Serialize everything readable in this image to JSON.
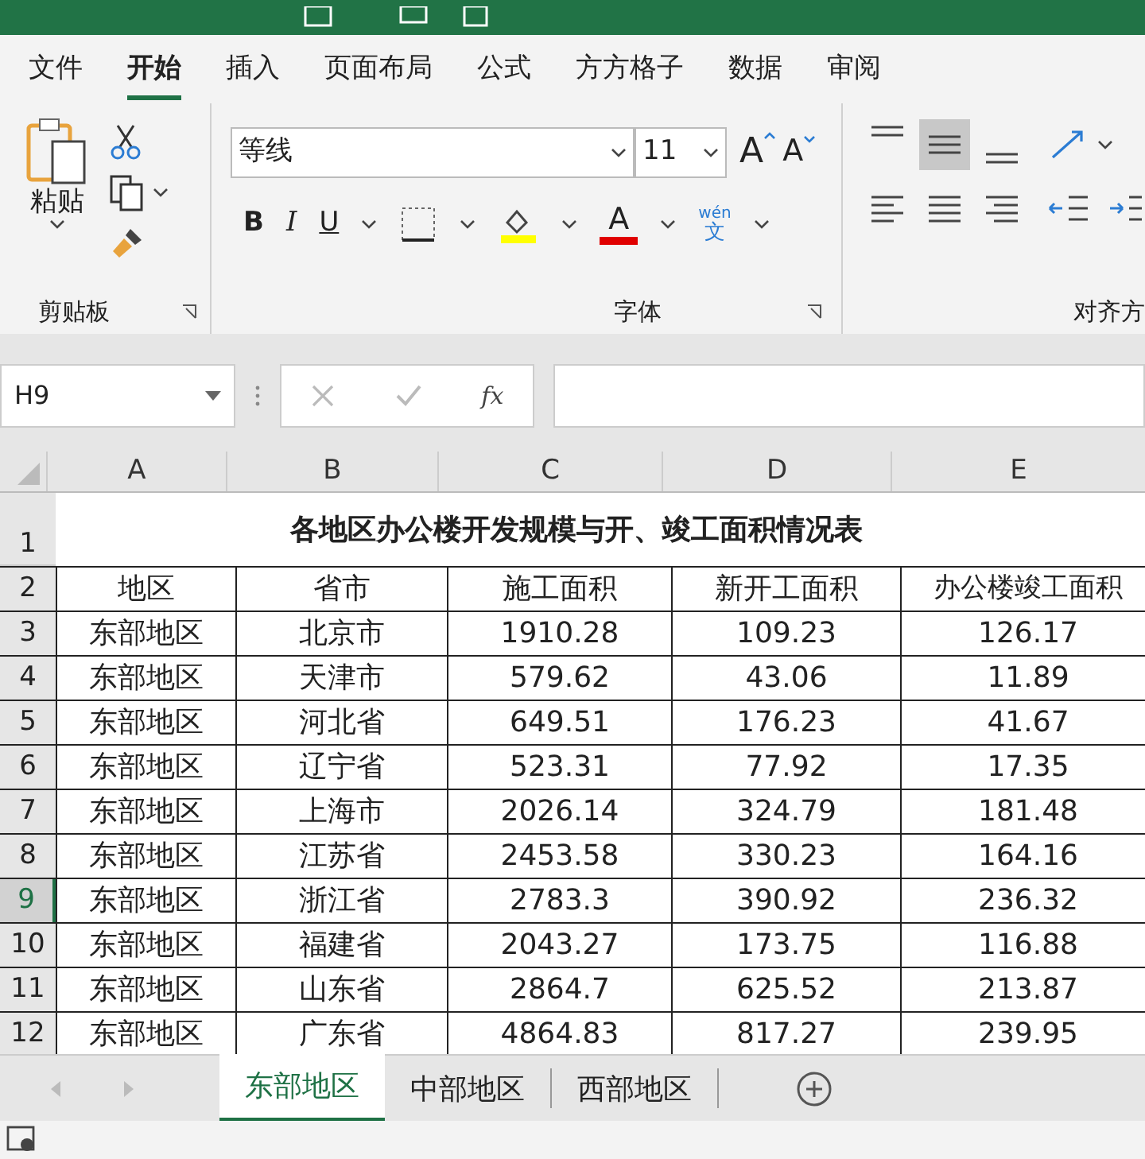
{
  "ribbon_tabs": [
    {
      "label": "文件",
      "selected": false
    },
    {
      "label": "开始",
      "selected": true
    },
    {
      "label": "插入",
      "selected": false
    },
    {
      "label": "页面布局",
      "selected": false
    },
    {
      "label": "公式",
      "selected": false
    },
    {
      "label": "方方格子",
      "selected": false
    },
    {
      "label": "数据",
      "selected": false
    },
    {
      "label": "审阅",
      "selected": false
    }
  ],
  "clipboard": {
    "paste_label": "粘贴",
    "group_label": "剪贴板"
  },
  "font": {
    "font_name": "等线",
    "font_size": "11",
    "grow_label": "A",
    "shrink_label": "A",
    "bold": "B",
    "italic": "I",
    "underline": "U",
    "font_color_label": "A",
    "phonetic_top": "wén",
    "phonetic_bottom": "文",
    "group_label": "字体"
  },
  "alignment": {
    "group_label": "对齐方",
    "middle_align_selected": true
  },
  "formula_bar": {
    "name_box": "H9",
    "fx": "fx"
  },
  "columns": [
    "A",
    "B",
    "C",
    "D",
    "E"
  ],
  "sheet": {
    "title": "各地区办公楼开发规模与开、竣工面积情况表",
    "headers": [
      "地区",
      "省市",
      "施工面积",
      "新开工面积",
      "办公楼竣工面积"
    ],
    "rows": [
      {
        "num": "3",
        "cells": [
          "东部地区",
          "北京市",
          "1910.28",
          "109.23",
          "126.17"
        ],
        "selected": false
      },
      {
        "num": "4",
        "cells": [
          "东部地区",
          "天津市",
          "579.62",
          "43.06",
          "11.89"
        ],
        "selected": false
      },
      {
        "num": "5",
        "cells": [
          "东部地区",
          "河北省",
          "649.51",
          "176.23",
          "41.67"
        ],
        "selected": false
      },
      {
        "num": "6",
        "cells": [
          "东部地区",
          "辽宁省",
          "523.31",
          "77.92",
          "17.35"
        ],
        "selected": false
      },
      {
        "num": "7",
        "cells": [
          "东部地区",
          "上海市",
          "2026.14",
          "324.79",
          "181.48"
        ],
        "selected": false
      },
      {
        "num": "8",
        "cells": [
          "东部地区",
          "江苏省",
          "2453.58",
          "330.23",
          "164.16"
        ],
        "selected": false
      },
      {
        "num": "9",
        "cells": [
          "东部地区",
          "浙江省",
          "2783.3",
          "390.92",
          "236.32"
        ],
        "selected": true
      },
      {
        "num": "10",
        "cells": [
          "东部地区",
          "福建省",
          "2043.27",
          "173.75",
          "116.88"
        ],
        "selected": false
      },
      {
        "num": "11",
        "cells": [
          "东部地区",
          "山东省",
          "2864.7",
          "625.52",
          "213.87"
        ],
        "selected": false
      },
      {
        "num": "12",
        "cells": [
          "东部地区",
          "广东省",
          "4864.83",
          "817.27",
          "239.95"
        ],
        "selected": false
      }
    ]
  },
  "title_row_num": "1",
  "header_row_num": "2",
  "sheet_tabs": [
    {
      "label": "东部地区",
      "selected": true
    },
    {
      "label": "中部地区",
      "selected": false
    },
    {
      "label": "西部地区",
      "selected": false
    }
  ]
}
